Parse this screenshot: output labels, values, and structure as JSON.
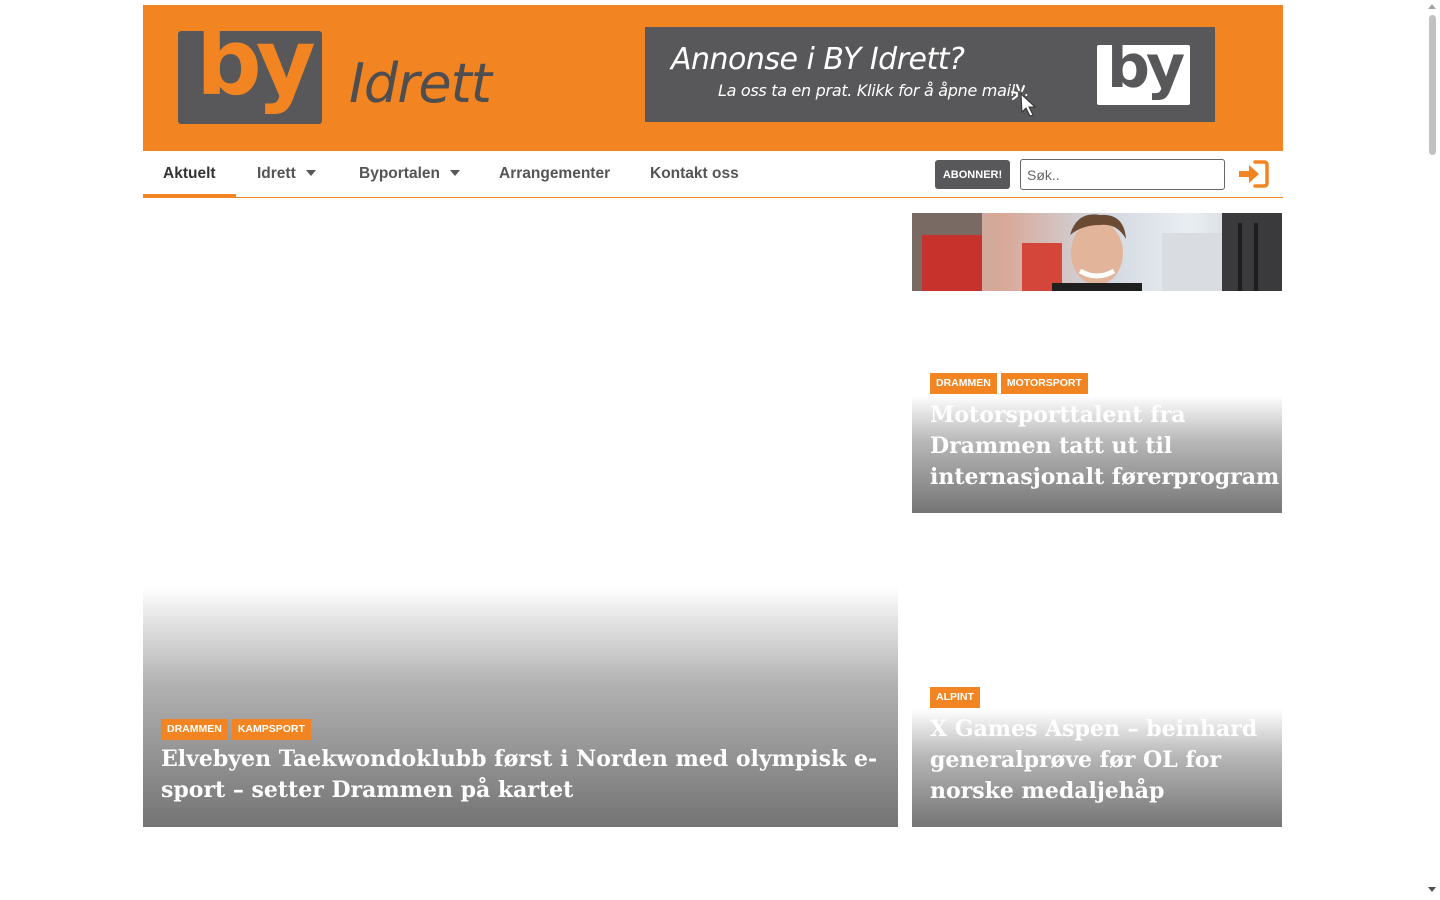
{
  "brand": {
    "logo_text": "by",
    "logo_sub": "Idrett",
    "accent_color": "#f28521",
    "dark_color": "#58585a"
  },
  "ad": {
    "title": "Annonse i BY Idrett?",
    "subtitle": "La oss ta en prat. Klikk for å åpne mail...",
    "logo_text": "by",
    "cursor_icon": "click-cursor-icon"
  },
  "nav": {
    "items": [
      {
        "label": "Aktuelt",
        "active": true
      },
      {
        "label": "Idrett",
        "dropdown": true
      },
      {
        "label": "Byportalen",
        "dropdown": true
      },
      {
        "label": "Arrangementer"
      },
      {
        "label": "Kontakt oss"
      }
    ],
    "subscribe_label": "ABONNER!",
    "search_placeholder": "Søk..",
    "login_icon": "login-icon"
  },
  "articles": {
    "main": {
      "tags": [
        "DRAMMEN",
        "KAMPSPORT"
      ],
      "title": "Elvebyen Taekwondoklubb først i Norden med olympisk e-sport – setter Drammen på kartet"
    },
    "side_top": {
      "tags": [
        "DRAMMEN",
        "MOTORSPORT"
      ],
      "title": "Motorsporttalent fra Drammen tatt ut til internasjonalt førerprogram"
    },
    "side_bottom": {
      "tags": [
        "ALPINT"
      ],
      "title": "X Games Aspen – beinhard generalprøve før OL for norske medaljehåp"
    }
  }
}
